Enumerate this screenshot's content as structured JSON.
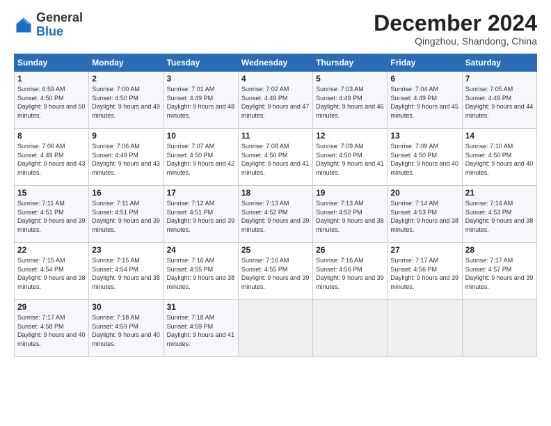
{
  "logo": {
    "general": "General",
    "blue": "Blue"
  },
  "header": {
    "month": "December 2024",
    "location": "Qingzhou, Shandong, China"
  },
  "days_of_week": [
    "Sunday",
    "Monday",
    "Tuesday",
    "Wednesday",
    "Thursday",
    "Friday",
    "Saturday"
  ],
  "weeks": [
    [
      {
        "day": 1,
        "sunrise": "6:59 AM",
        "sunset": "4:50 PM",
        "daylight": "9 hours and 50 minutes."
      },
      {
        "day": 2,
        "sunrise": "7:00 AM",
        "sunset": "4:50 PM",
        "daylight": "9 hours and 49 minutes."
      },
      {
        "day": 3,
        "sunrise": "7:01 AM",
        "sunset": "4:49 PM",
        "daylight": "9 hours and 48 minutes."
      },
      {
        "day": 4,
        "sunrise": "7:02 AM",
        "sunset": "4:49 PM",
        "daylight": "9 hours and 47 minutes."
      },
      {
        "day": 5,
        "sunrise": "7:03 AM",
        "sunset": "4:49 PM",
        "daylight": "9 hours and 46 minutes."
      },
      {
        "day": 6,
        "sunrise": "7:04 AM",
        "sunset": "4:49 PM",
        "daylight": "9 hours and 45 minutes."
      },
      {
        "day": 7,
        "sunrise": "7:05 AM",
        "sunset": "4:49 PM",
        "daylight": "9 hours and 44 minutes."
      }
    ],
    [
      {
        "day": 8,
        "sunrise": "7:06 AM",
        "sunset": "4:49 PM",
        "daylight": "9 hours and 43 minutes."
      },
      {
        "day": 9,
        "sunrise": "7:06 AM",
        "sunset": "4:49 PM",
        "daylight": "9 hours and 43 minutes."
      },
      {
        "day": 10,
        "sunrise": "7:07 AM",
        "sunset": "4:50 PM",
        "daylight": "9 hours and 42 minutes."
      },
      {
        "day": 11,
        "sunrise": "7:08 AM",
        "sunset": "4:50 PM",
        "daylight": "9 hours and 41 minutes."
      },
      {
        "day": 12,
        "sunrise": "7:09 AM",
        "sunset": "4:50 PM",
        "daylight": "9 hours and 41 minutes."
      },
      {
        "day": 13,
        "sunrise": "7:09 AM",
        "sunset": "4:50 PM",
        "daylight": "9 hours and 40 minutes."
      },
      {
        "day": 14,
        "sunrise": "7:10 AM",
        "sunset": "4:50 PM",
        "daylight": "9 hours and 40 minutes."
      }
    ],
    [
      {
        "day": 15,
        "sunrise": "7:11 AM",
        "sunset": "4:51 PM",
        "daylight": "9 hours and 39 minutes."
      },
      {
        "day": 16,
        "sunrise": "7:11 AM",
        "sunset": "4:51 PM",
        "daylight": "9 hours and 39 minutes."
      },
      {
        "day": 17,
        "sunrise": "7:12 AM",
        "sunset": "4:51 PM",
        "daylight": "9 hours and 39 minutes."
      },
      {
        "day": 18,
        "sunrise": "7:13 AM",
        "sunset": "4:52 PM",
        "daylight": "9 hours and 39 minutes."
      },
      {
        "day": 19,
        "sunrise": "7:13 AM",
        "sunset": "4:52 PM",
        "daylight": "9 hours and 38 minutes."
      },
      {
        "day": 20,
        "sunrise": "7:14 AM",
        "sunset": "4:53 PM",
        "daylight": "9 hours and 38 minutes."
      },
      {
        "day": 21,
        "sunrise": "7:14 AM",
        "sunset": "4:53 PM",
        "daylight": "9 hours and 38 minutes."
      }
    ],
    [
      {
        "day": 22,
        "sunrise": "7:15 AM",
        "sunset": "4:54 PM",
        "daylight": "9 hours and 38 minutes."
      },
      {
        "day": 23,
        "sunrise": "7:15 AM",
        "sunset": "4:54 PM",
        "daylight": "9 hours and 38 minutes."
      },
      {
        "day": 24,
        "sunrise": "7:16 AM",
        "sunset": "4:55 PM",
        "daylight": "9 hours and 38 minutes."
      },
      {
        "day": 25,
        "sunrise": "7:16 AM",
        "sunset": "4:55 PM",
        "daylight": "9 hours and 39 minutes."
      },
      {
        "day": 26,
        "sunrise": "7:16 AM",
        "sunset": "4:56 PM",
        "daylight": "9 hours and 39 minutes."
      },
      {
        "day": 27,
        "sunrise": "7:17 AM",
        "sunset": "4:56 PM",
        "daylight": "9 hours and 39 minutes."
      },
      {
        "day": 28,
        "sunrise": "7:17 AM",
        "sunset": "4:57 PM",
        "daylight": "9 hours and 39 minutes."
      }
    ],
    [
      {
        "day": 29,
        "sunrise": "7:17 AM",
        "sunset": "4:58 PM",
        "daylight": "9 hours and 40 minutes."
      },
      {
        "day": 30,
        "sunrise": "7:18 AM",
        "sunset": "4:59 PM",
        "daylight": "9 hours and 40 minutes."
      },
      {
        "day": 31,
        "sunrise": "7:18 AM",
        "sunset": "4:59 PM",
        "daylight": "9 hours and 41 minutes."
      },
      null,
      null,
      null,
      null
    ]
  ]
}
